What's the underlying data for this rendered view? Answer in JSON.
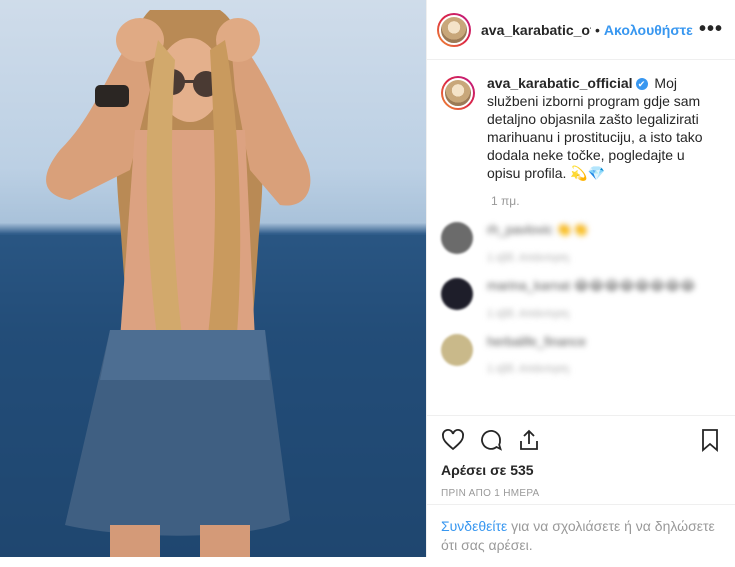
{
  "header": {
    "username": "ava_karabatic_offici",
    "separator": "•",
    "follow_label": "Ακολουθήστε",
    "more_label": "•••"
  },
  "caption": {
    "username": "ava_karabatic_official",
    "verified": "✔",
    "text": "Moj službeni izborni program gdje sam detaljno objasnila zašto legalizirati marihuanu i prostituciju, a isto tako dodala neke točke, pogledajte u opisu profila. 💫💎",
    "time": "1 πμ."
  },
  "comments": [
    {
      "name": "rh_pavlovic",
      "text": "👏👏",
      "meta": "1 εβδ.   Απάντηση"
    },
    {
      "name": "marina_karnat",
      "text": "😂😂😂😂😂😂😂😂",
      "meta": "1 εβδ.   Απάντηση"
    },
    {
      "name": "herbalife_finance",
      "text": "",
      "meta": "1 εβδ.   Απάντηση"
    }
  ],
  "actions": {
    "likes": "Αρέσει σε 535",
    "ago": "ΠΡΙΝ ΑΠΟ 1 ΗΜΕΡΑ"
  },
  "login": {
    "link": "Συνδεθείτε",
    "rest": " για να σχολιάσετε ή να δηλώσετε ότι σας αρέσει."
  },
  "colors": {
    "link": "#3897f0",
    "muted": "#999999",
    "text": "#262626"
  }
}
